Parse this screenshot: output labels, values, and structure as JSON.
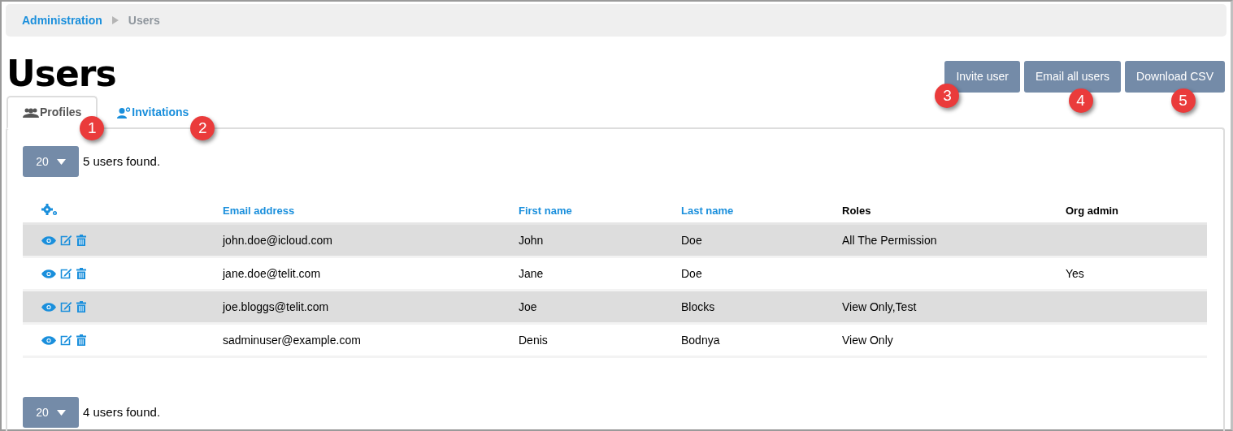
{
  "breadcrumb": [
    {
      "label": "Administration",
      "current": false
    },
    {
      "label": "Users",
      "current": true
    }
  ],
  "title": "Users",
  "actions": [
    {
      "label": "Invite user",
      "callout": "3"
    },
    {
      "label": "Email all users",
      "callout": "4"
    },
    {
      "label": "Download CSV",
      "callout": "5"
    }
  ],
  "tabs": [
    {
      "label": "Profiles",
      "kind": "profiles",
      "selected": true,
      "callout": "1"
    },
    {
      "label": "Invitations",
      "kind": "invitations",
      "selected": false,
      "callout": "2"
    }
  ],
  "top_pager": {
    "page_size": "20",
    "summary": "5 users found."
  },
  "table": {
    "columns": [
      {
        "kind": "actions"
      },
      {
        "kind": "text",
        "label": "Email address",
        "color": "#1a8fdc"
      },
      {
        "kind": "text",
        "label": "First name",
        "color": "#1a8fdc"
      },
      {
        "kind": "text",
        "label": "Last name",
        "color": "#1a8fdc"
      },
      {
        "kind": "text",
        "label": "Roles",
        "color": "#000000"
      },
      {
        "kind": "text",
        "label": "Org admin",
        "color": "#000000"
      }
    ],
    "rows": [
      {
        "email": "john.doe@icloud.com",
        "first_name": "John",
        "last_name": "Doe",
        "roles": "All The Permission"
      },
      {
        "email": "jane.doe@telit.com",
        "first_name": "Jane",
        "last_name": "Doe",
        "org_admin": "Yes"
      },
      {
        "email": "joe.bloggs@telit.com",
        "first_name": "Joe",
        "last_name": "Blocks",
        "roles": "View Only,Test"
      },
      {
        "email": "sadminuser@example.com",
        "first_name": "Denis",
        "last_name": "Bodnya",
        "roles": "View Only"
      }
    ]
  },
  "bottom_pager": {
    "page_size": "20",
    "summary": "4 users found."
  }
}
